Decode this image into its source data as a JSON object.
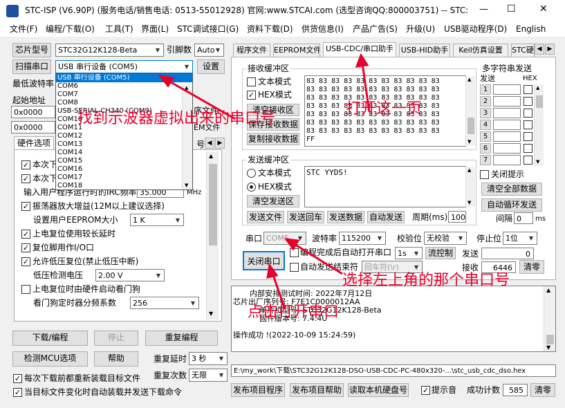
{
  "window": {
    "title": "STC-ISP (V6.90P) (服务电话/销售电话: 0513-55012928) 官网:www.STCAI.com  (选型咨询QQ:800003751) -- STC:...",
    "min": "—",
    "max": "☐",
    "close": "✕"
  },
  "menu": [
    "文件(F)",
    "编程/下载(O)",
    "工具(T)",
    "界面(L)",
    "STC调试接口(G)",
    "资料下载(D)",
    "供货信息(I)",
    "产品广告(S)",
    "升级(U)",
    "USB驱动程序(D)",
    "English"
  ],
  "left": {
    "chip_btn": "芯片型号",
    "chip_value": "STC32G12K128-Beta",
    "pins_label": "引脚数",
    "pins_value": "Auto",
    "scan_btn": "扫描串口",
    "port_value": "USB 串行设备 (COM5)",
    "settings_btn": "设置",
    "baud_label": "最低波特率",
    "start_label": "起始地址",
    "addr1": "0x0000",
    "addr2": "0x0000",
    "hw_tab": "硬件选项",
    "partial_r1": "序文件",
    "partial_r2": "EM文件",
    "partial_r3": "号",
    "opts": [
      {
        "checked": "✓",
        "label": "本次下"
      },
      {
        "checked": "✓",
        "label": "本次下"
      },
      {
        "checked": "",
        "label": "输入用户程序运行时的IRC频率",
        "value": "35.000",
        "unit": "MHz"
      },
      {
        "checked": "✓",
        "label": "振荡器放大增益(12M以上建议选择)"
      },
      {
        "checked": "",
        "label": "设置用户EEPROM大小",
        "value": "1    K"
      },
      {
        "checked": "✓",
        "label": "上电复位使用较长延时"
      },
      {
        "checked": "✓",
        "label": "复位脚用作I/O口"
      },
      {
        "checked": "✓",
        "label": "允许低压复位(禁止低压中断)"
      },
      {
        "checked": "",
        "label": "低压检测电压",
        "value": "2.00 V"
      },
      {
        "checked": "",
        "label": "上电复位时由硬件启动看门狗"
      },
      {
        "checked": "",
        "label": "看门狗定时器分频系数",
        "value": "256"
      }
    ],
    "download_btn": "下载/编程",
    "stop_btn": "停止",
    "redownload_btn": "重复编程",
    "detect_btn": "检测MCU选项",
    "help_btn": "帮助",
    "delay_label": "重复延时",
    "delay_value": "3 秒",
    "count_label": "重复次数",
    "count_value": "无限",
    "reload_label": "每次下载前都重新装载目标文件",
    "autoload_label": "当目标文件变化时自动装载并发送下载命令"
  },
  "dropdown": [
    "USB 串行设备 (COM5)",
    "COM6",
    "COM7",
    "COM8",
    "USB-SERIAL CH340 (COM9)",
    "COM10",
    "COM11",
    "COM12",
    "COM13",
    "COM14",
    "COM15",
    "COM16",
    "COM17",
    "COM18"
  ],
  "tabs": [
    "程序文件",
    "EEPROM文件",
    "USB-CDC/串口助手",
    "USB-HID助手",
    "Keil仿真设置",
    "STC硬"
  ],
  "recv": {
    "group": "接收缓冲区",
    "text_mode": "文本模式",
    "hex_mode": "HEX模式",
    "clear_btn": "清空接收区",
    "save_btn": "保存接收数据",
    "copy_btn": "复制接收数据",
    "lines": [
      "83 83 83 83 83 83 83 83 83 83 83",
      "83 83 83 83 83 83 83 83 83 83 83",
      "83 83 83 83 83 83 83 83 83 83 83",
      "83 83 83 83 83 83 83 83 83 83 83",
      "83 83 83 83 83 83 83 83 83 83 83",
      "83 83 83 83 83 83 83 83 83 83 83",
      "83 83 83 83 83 83 83 83 83 83 83",
      "FF"
    ]
  },
  "send": {
    "group": "发送缓冲区",
    "text_mode": "文本模式",
    "hex_mode": "HEX模式",
    "clear_btn": "清空发送区",
    "content": "STC YYDS!",
    "send_file": "发送文件",
    "send_cr": "发送回车",
    "send_data": "发送数据",
    "auto_send": "自动发送",
    "period_label": "周期(ms)",
    "period_value": "100"
  },
  "multi": {
    "title": "多字符串发送",
    "send": "发送",
    "hex": "HEX",
    "rows": [
      "1",
      "2",
      "3",
      "4",
      "5",
      "6",
      "7"
    ],
    "close_hint": "关闭提示",
    "clear_all": "清空全部数据",
    "auto_loop": "自动循环发送",
    "interval_label": "间隔",
    "interval_value": "0",
    "ms": "ms"
  },
  "serial": {
    "port_label": "串口",
    "port_value": "COM5",
    "baud_label": "波特率",
    "baud_value": "115200",
    "parity_label": "校验位",
    "parity_value": "无校验",
    "stop_label": "停止位",
    "stop_value": "1位",
    "close_btn": "关闭串口",
    "open_after": "编程完成后自动打开串口",
    "open_after_val": "1s",
    "flow_btn": "流控制",
    "send_label": "发送",
    "send_count": "0",
    "auto_end": "自动发送结束符",
    "end_value": "回车符(\\r)",
    "recv_label": "接收",
    "recv_count": "6446",
    "clear_btn": "清零"
  },
  "log": [
    "内部安排测试时间: 2022年7月12日",
    "芯片出厂序列号: F7E1C0000012AA",
    "单片机型号: STC32G12K128-Beta",
    "固件版本号: 7.4.4U",
    "",
    "操作成功 !(2022-10-09 15:24:59)"
  ],
  "path": "E:\\my_work\\下载\\STC32G12K128-DSO-USB-CDC-PC-480x320-...\\stc_usb_cdc_dso.hex",
  "bottom": {
    "publish_btn": "发布项目程序",
    "publish_help_btn": "发布项目帮助",
    "read_disk_btn": "读取本机硬盘号",
    "sound_label": "提示音",
    "success_label": "成功计数",
    "success_value": "585",
    "clear_btn": "清零"
  },
  "annotations": {
    "a1": "找到示波器虚拟出来的串口号",
    "a2": "打开这一页",
    "a3": "选择左上角的那个串口号",
    "a4": "点击打开串口"
  },
  "colors": {
    "annotation": "#e8002a",
    "selection": "#0078d7"
  }
}
